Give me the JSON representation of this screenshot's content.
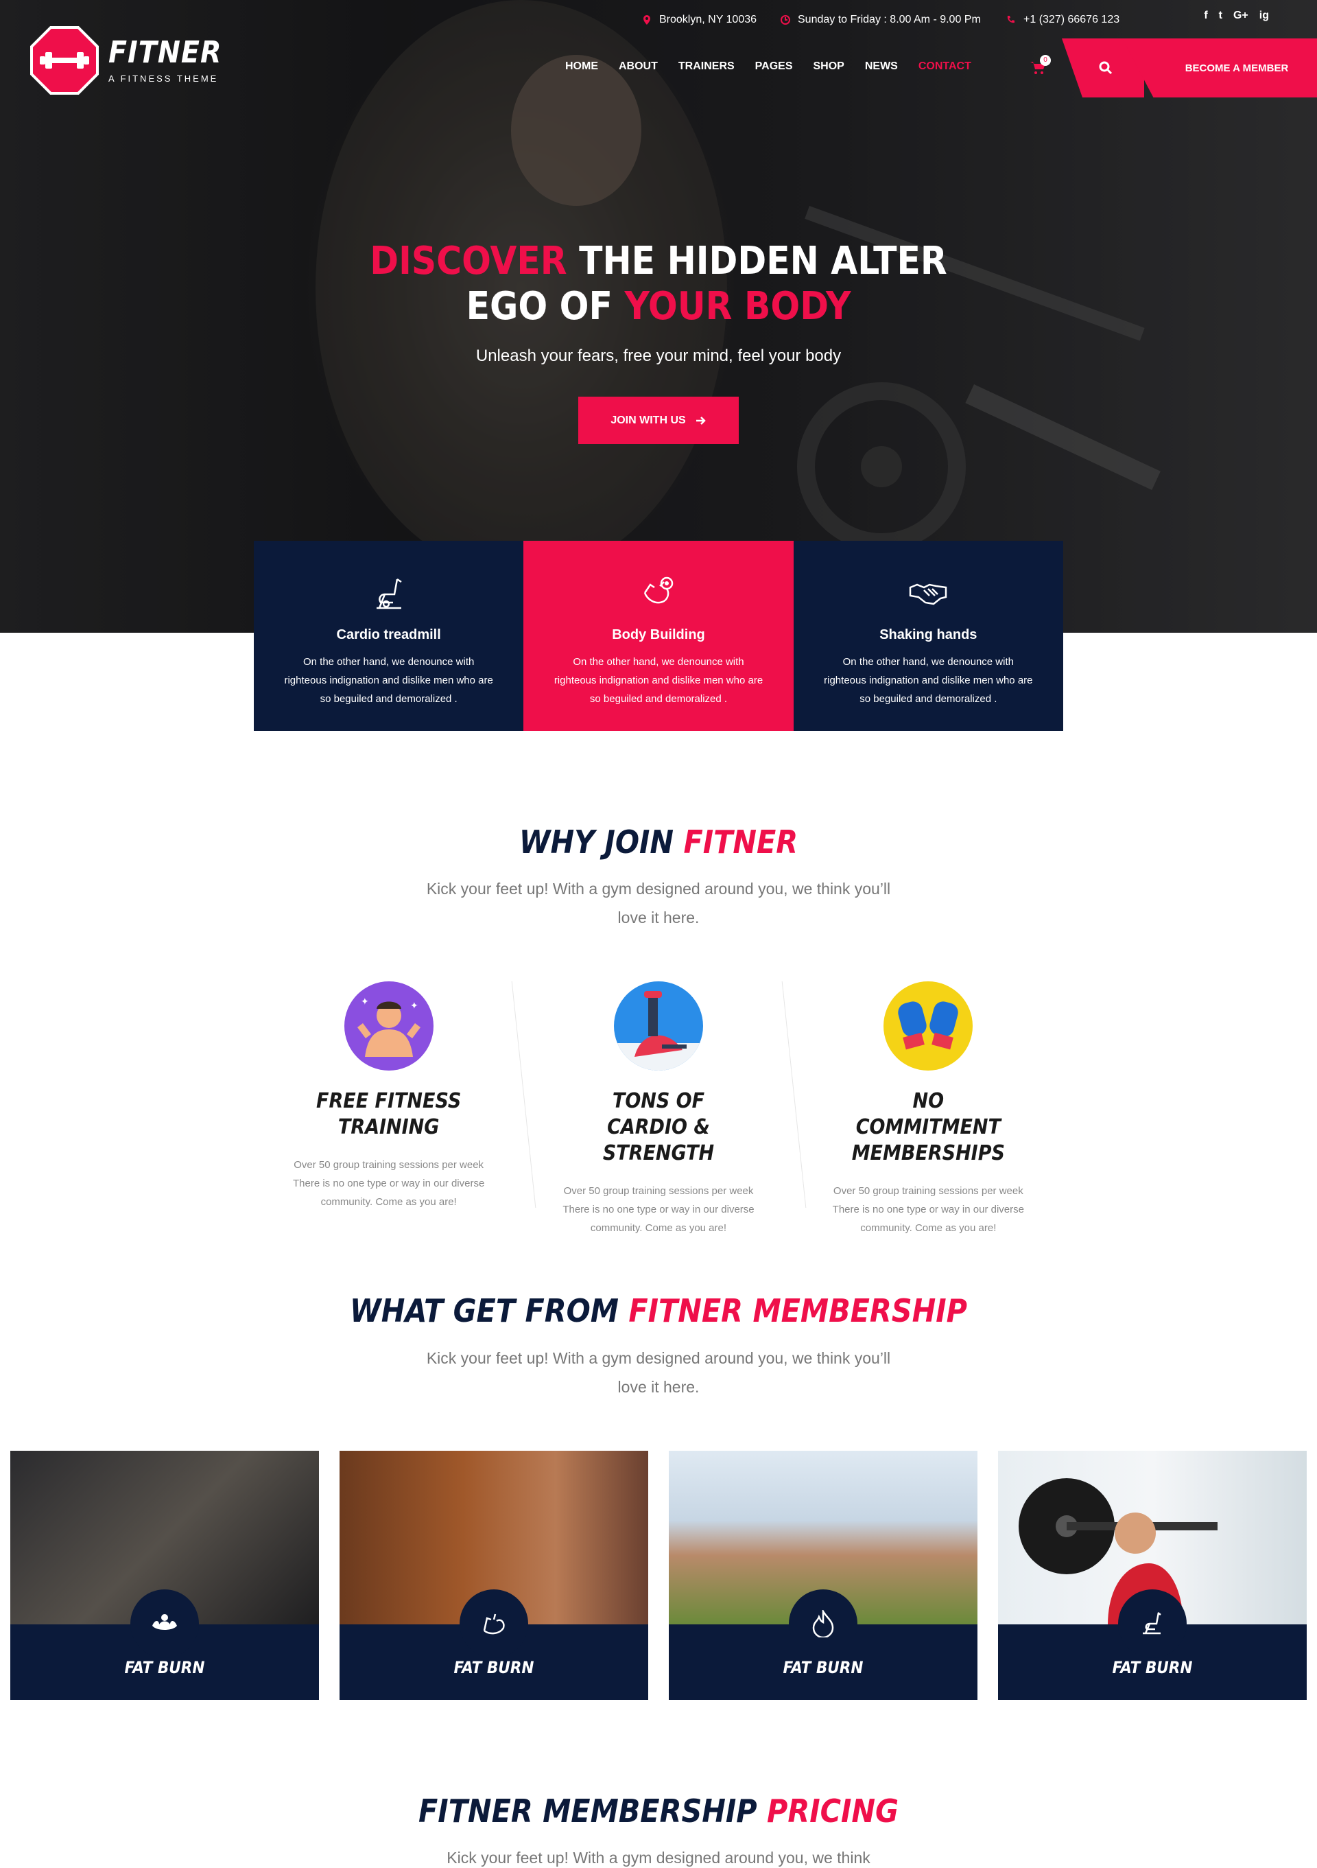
{
  "topbar": {
    "location": "Brooklyn, NY 10036",
    "hours": "Sunday to Friday : 8.00 Am - 9.00 Pm",
    "phone": "+1 (327) 66676 123",
    "social": [
      "f",
      "t",
      "G+",
      "ig"
    ]
  },
  "brand": {
    "name": "FITNER",
    "tagline": "A FITNESS THEME"
  },
  "nav": {
    "items": [
      "HOME",
      "ABOUT",
      "TRAINERS",
      "PAGES",
      "SHOP",
      "NEWS",
      "CONTACT"
    ],
    "active": "CONTACT",
    "cart_count": "0",
    "member_button": "BECOME A MEMBER"
  },
  "hero": {
    "line1_pink": "DISCOVER",
    "line1_white": " THE HIDDEN ALTER",
    "line2_white": "EGO OF ",
    "line2_pink": "YOUR BODY",
    "subtitle": "Unleash your fears, free your mind, feel your body",
    "cta": "JOIN WITH US"
  },
  "features": [
    {
      "icon": "treadmill-icon",
      "title": "Cardio treadmill",
      "text": "On the other hand, we denounce with righteous indignation and dislike men who are so beguiled and demoralized ."
    },
    {
      "icon": "arm-icon",
      "title": "Body Building",
      "text": "On the other hand, we denounce with righteous indignation and dislike men who are so beguiled and demoralized ."
    },
    {
      "icon": "handshake-icon",
      "title": "Shaking hands",
      "text": "On the other hand, we denounce with righteous indignation and dislike men who are so beguiled and demoralized ."
    }
  ],
  "why": {
    "title_dark": "WHY JOIN ",
    "title_pink": "FITNER",
    "subtitle": "Kick your feet up! With a gym designed around you, we think you’ll love it here.",
    "items": [
      {
        "icon": "trainer-icon",
        "color": "#8a4fe0",
        "title": "FREE FITNESS TRAINING",
        "text": "Over 50 group training sessions per week There is no one type or way in our diverse community. Come as you are!"
      },
      {
        "icon": "cardio-machine-icon",
        "color": "#2a8de8",
        "title": "TONS OF CARDIO & STRENGTH",
        "text": "Over 50 group training sessions per week There is no one type or way in our diverse community. Come as you are!"
      },
      {
        "icon": "boxing-gloves-icon",
        "color": "#f5d316",
        "title": "NO COMMITMENT MEMBERSHIPS",
        "text": "Over 50 group training sessions per week There is no one type or way in our diverse community. Come as you are!"
      }
    ]
  },
  "membership": {
    "title_dark": "WHAT GET FROM ",
    "title_pink": "FITNER MEMBERSHIP",
    "subtitle": "Kick your feet up! With a gym designed around you, we think you’ll love it here.",
    "cards": [
      {
        "icon": "muscle-icon",
        "label": "FAT BURN"
      },
      {
        "icon": "bicep-icon",
        "label": "FAT BURN"
      },
      {
        "icon": "flame-icon",
        "label": "FAT BURN"
      },
      {
        "icon": "treadmill-icon",
        "label": "FAT BURN"
      }
    ]
  },
  "pricing": {
    "title_dark": "FITNER MEMBERSHIP ",
    "title_pink": "PRICING",
    "subtitle": "Kick your feet up! With a gym designed around you, we think"
  },
  "colors": {
    "accent": "#ef0f4a",
    "navy": "#0b1a3a"
  }
}
